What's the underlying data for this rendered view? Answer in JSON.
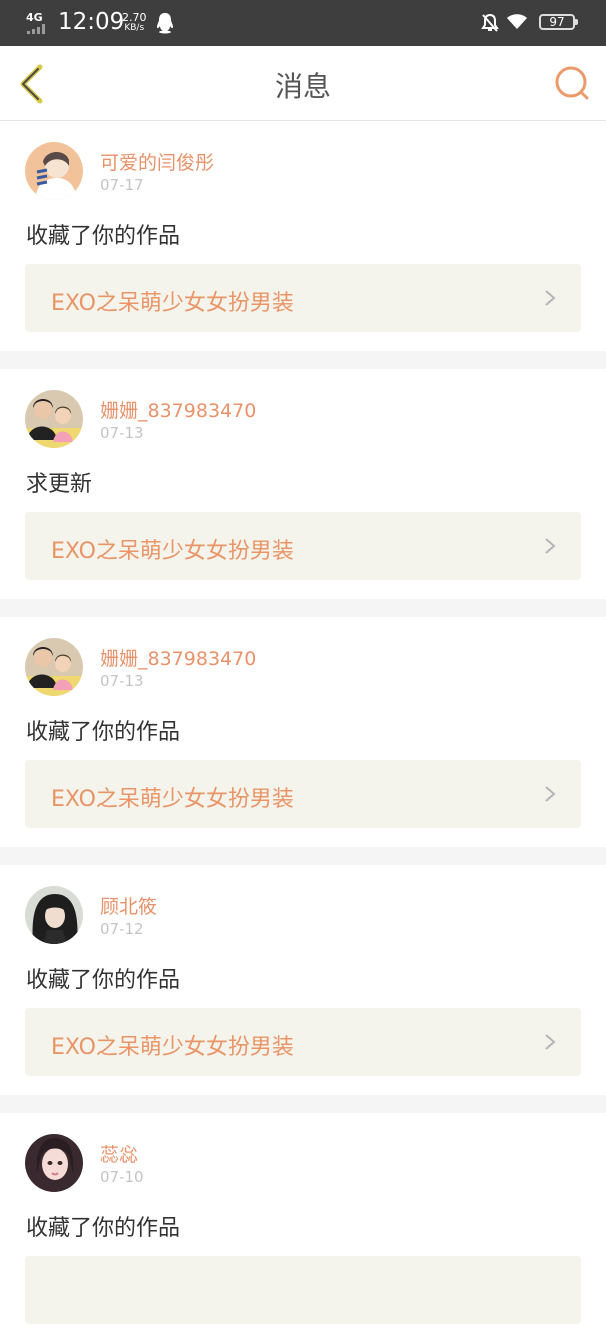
{
  "status_bar": {
    "network": "4G",
    "time": "12:09",
    "speed_value": "2.70",
    "speed_unit": "KB/s",
    "battery": "97"
  },
  "nav": {
    "title": "消息"
  },
  "messages": [
    {
      "user": "可爱的闫俊彤",
      "date": "07-17",
      "text": "收藏了你的作品",
      "work": "EXO之呆萌少女女扮男装"
    },
    {
      "user": "姗姗_837983470",
      "date": "07-13",
      "text": "求更新",
      "work": "EXO之呆萌少女女扮男装"
    },
    {
      "user": "姗姗_837983470",
      "date": "07-13",
      "text": "收藏了你的作品",
      "work": "EXO之呆萌少女女扮男装"
    },
    {
      "user": "顾北筱",
      "date": "07-12",
      "text": "收藏了你的作品",
      "work": "EXO之呆萌少女女扮男装"
    },
    {
      "user": "蕊惢",
      "date": "07-10",
      "text": "收藏了你的作品",
      "work": ""
    }
  ],
  "colors": {
    "accent": "#e8926a",
    "status_bar_bg": "#3e3e3e",
    "work_card_bg": "#f4f3ec",
    "back_icon": "#d8c845"
  },
  "icons": {
    "back": "chevron-left-icon",
    "search": "search-icon",
    "work_arrow": "chevron-right-icon",
    "qq": "qq-penguin-icon",
    "bell_off": "bell-off-icon",
    "wifi": "wifi-icon"
  }
}
